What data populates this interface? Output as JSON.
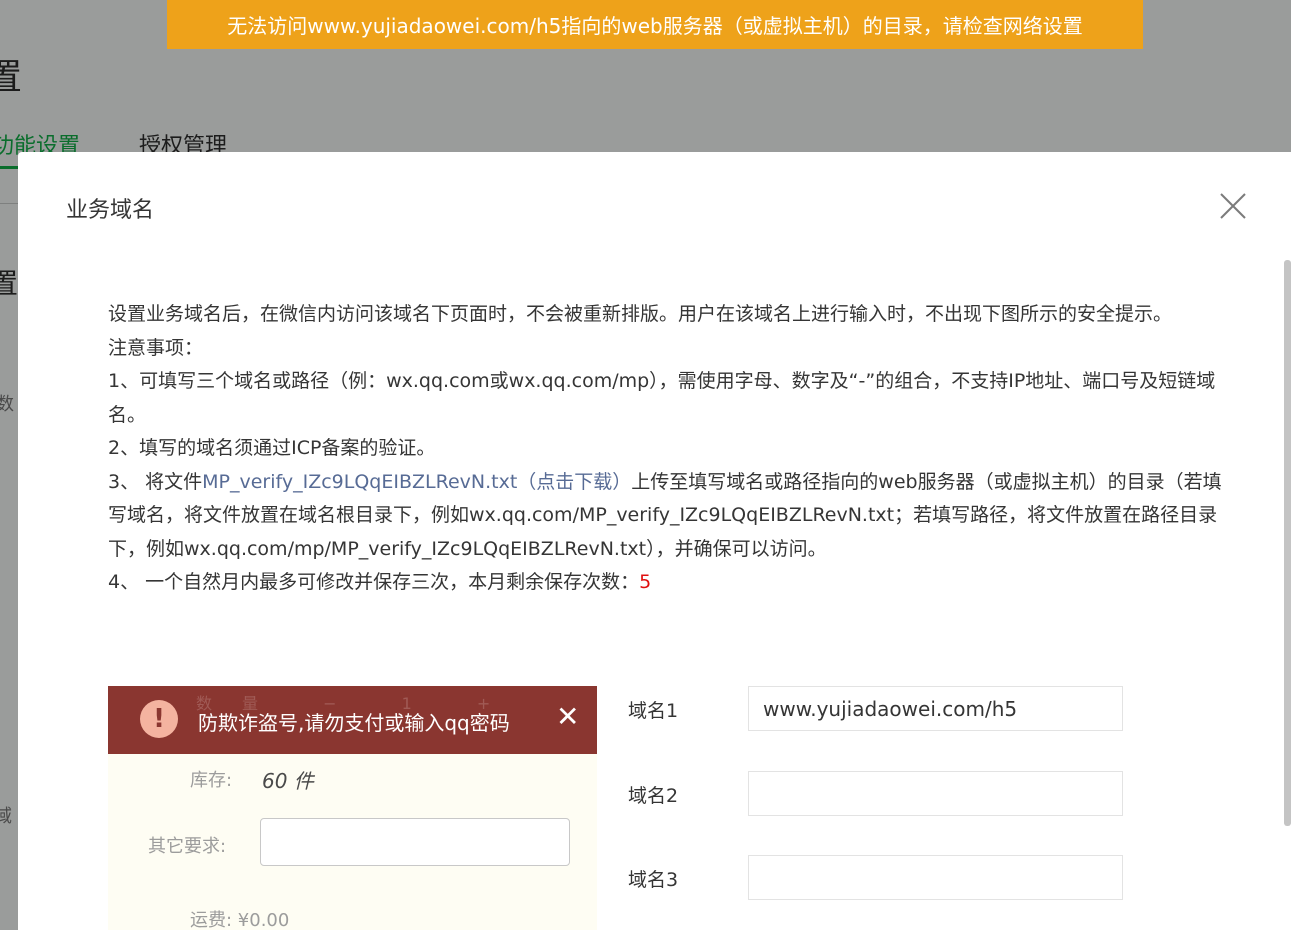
{
  "toast": {
    "message": "无法访问www.yujiadaowei.com/h5指向的web服务器（或虚拟主机）的目录，请检查网络设置"
  },
  "background": {
    "title_fragment": "置",
    "tabs": [
      {
        "label": "功能设置",
        "active": true
      },
      {
        "label": "授权管理",
        "active": false
      }
    ],
    "side_fragments": [
      "置",
      "数",
      "域"
    ]
  },
  "dialog": {
    "title": "业务域名",
    "intro": "设置业务域名后，在微信内访问该域名下页面时，不会被重新排版。用户在该域名上进行输入时，不出现下图所示的安全提示。",
    "notice_heading": "注意事项：",
    "item1": "1、可填写三个域名或路径（例：wx.qq.com或wx.qq.com/mp），需使用字母、数字及“-”的组合，不支持IP地址、端口号及短链域名。",
    "item2": "2、填写的域名须通过ICP备案的验证。",
    "item3_prefix": "3、 将文件",
    "item3_link": "MP_verify_IZc9LQqEIBZLRevN.txt（点击下载）",
    "item3_suffix": "上传至填写域名或路径指向的web服务器（或虚拟主机）的目录（若填写域名，将文件放置在域名根目录下，例如wx.qq.com/MP_verify_IZc9LQqEIBZLRevN.txt；若填写路径，将文件放置在路径目录下，例如wx.qq.com/mp/MP_verify_IZc9LQqEIBZLRevN.txt），并确保可以访问。",
    "item4_prefix": "4、 一个自然月内最多可修改并保存三次，本月剩余保存次数：",
    "item4_count": "5",
    "sample": {
      "ghost_row": "数量 − 1 +",
      "alert_glyph": "!",
      "warning_text": "防欺诈盗号,请勿支付或输入qq密码",
      "close_glyph": "✕",
      "stock_label": "库存:",
      "stock_value": "60 件",
      "other_label": "其它要求:",
      "shipping": "运费:  ¥0.00"
    },
    "domains": [
      {
        "label": "域名1",
        "value": "www.yujiadaowei.com/h5"
      },
      {
        "label": "域名2",
        "value": ""
      },
      {
        "label": "域名3",
        "value": ""
      }
    ]
  },
  "colors": {
    "toast_bg": "#eea21a",
    "active_tab": "#0a6d2c",
    "link": "#576b95",
    "count_red": "#e01010",
    "sample_banner": "#8a3630"
  }
}
